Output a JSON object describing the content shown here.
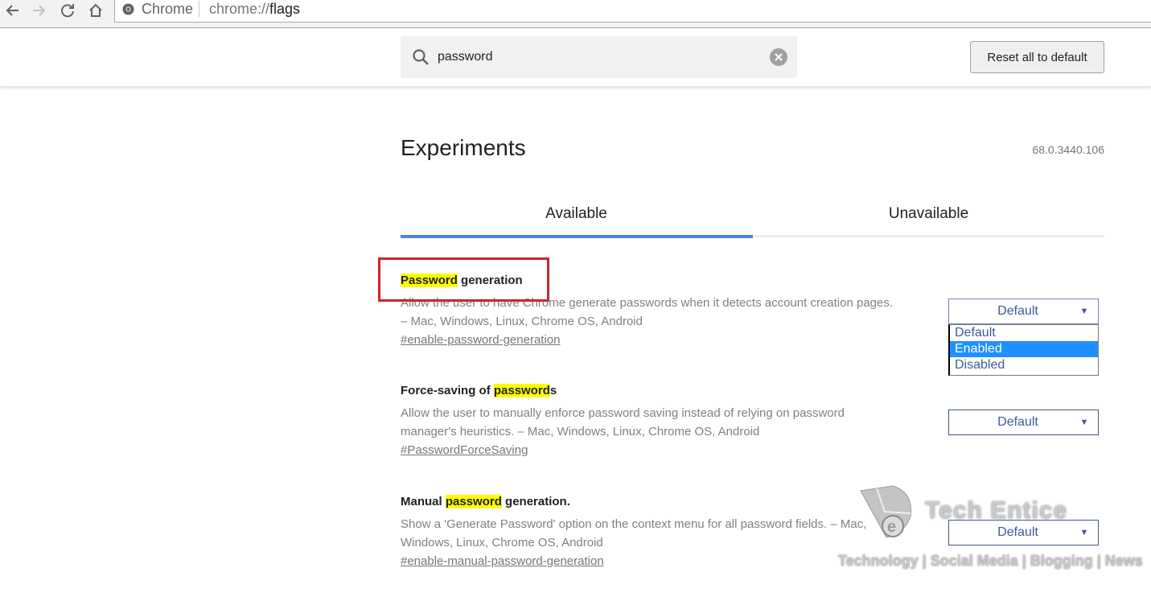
{
  "browser": {
    "site_label": "Chrome",
    "url_prefix": "chrome://",
    "url_host": "flags",
    "icons": [
      "back-arrow-icon",
      "forward-arrow-icon",
      "reload-icon",
      "home-icon",
      "chrome-logo-icon"
    ]
  },
  "header": {
    "search": {
      "value": "password",
      "icon": "search-icon",
      "clear_icon": "clear-icon"
    },
    "reset_label": "Reset all to default"
  },
  "page": {
    "title": "Experiments",
    "version": "68.0.3440.106"
  },
  "tabs": [
    {
      "label": "Available",
      "active": true
    },
    {
      "label": "Unavailable",
      "active": false
    }
  ],
  "experiments": [
    {
      "title_highlight": "Password",
      "title_rest": " generation",
      "description_line1": "Allow the user to have Chrome generate passwords when it detects account creation pages.",
      "description_line2": "– Mac, Windows, Linux, Chrome OS, Android",
      "link": "#enable-password-generation",
      "select_value": "Default",
      "dropdown_open": true,
      "options": [
        "Default",
        "Enabled",
        "Disabled"
      ],
      "highlighted_option": "Enabled"
    },
    {
      "title_pre": "Force-saving of ",
      "title_highlight": "password",
      "title_rest": "s",
      "description_line1": "Allow the user to manually enforce password saving instead of relying on password",
      "description_line2": "manager's heuristics. – Mac, Windows, Linux, Chrome OS, Android",
      "link": "#PasswordForceSaving",
      "select_value": "Default"
    },
    {
      "title_pre": "Manual ",
      "title_highlight": "password",
      "title_rest": " generation.",
      "description_line1": "Show a 'Generate Password' option on the context menu for all password fields. – Mac,",
      "description_line2": "Windows, Linux, Chrome OS, Android",
      "link": "#enable-manual-password-generation",
      "select_value": "Default"
    }
  ],
  "select_arrow": "▼",
  "annotation": {
    "color": "#d0232b"
  },
  "colors": {
    "accent": "#4a86d4",
    "highlight": "#ffff00",
    "selected_option": "#1e90ff"
  },
  "watermark": {
    "brand": "Tech Entice",
    "tagline": "Technology | Social Media | Blogging | News"
  }
}
